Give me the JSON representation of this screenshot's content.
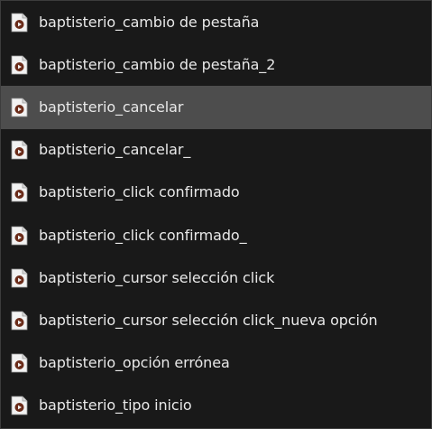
{
  "colors": {
    "background": "#191919",
    "selected_row": "#4d4d4d",
    "text": "#e8e8e8",
    "icon_body": "#f2f2f2",
    "icon_accent": "#6b2c1a"
  },
  "files": [
    {
      "name": "baptisterio_cambio de pestaña",
      "icon": "audio-file-icon",
      "selected": false
    },
    {
      "name": "baptisterio_cambio de pestaña_2",
      "icon": "audio-file-icon",
      "selected": false
    },
    {
      "name": "baptisterio_cancelar",
      "icon": "audio-file-icon",
      "selected": true
    },
    {
      "name": "baptisterio_cancelar_",
      "icon": "audio-file-icon",
      "selected": false
    },
    {
      "name": "baptisterio_click confirmado",
      "icon": "audio-file-icon",
      "selected": false
    },
    {
      "name": "baptisterio_click confirmado_",
      "icon": "audio-file-icon",
      "selected": false
    },
    {
      "name": "baptisterio_cursor selección click",
      "icon": "audio-file-icon",
      "selected": false
    },
    {
      "name": "baptisterio_cursor selección click_nueva opción",
      "icon": "audio-file-icon",
      "selected": false
    },
    {
      "name": "baptisterio_opción errónea",
      "icon": "audio-file-icon",
      "selected": false
    },
    {
      "name": "baptisterio_tipo inicio",
      "icon": "audio-file-icon",
      "selected": false
    }
  ]
}
